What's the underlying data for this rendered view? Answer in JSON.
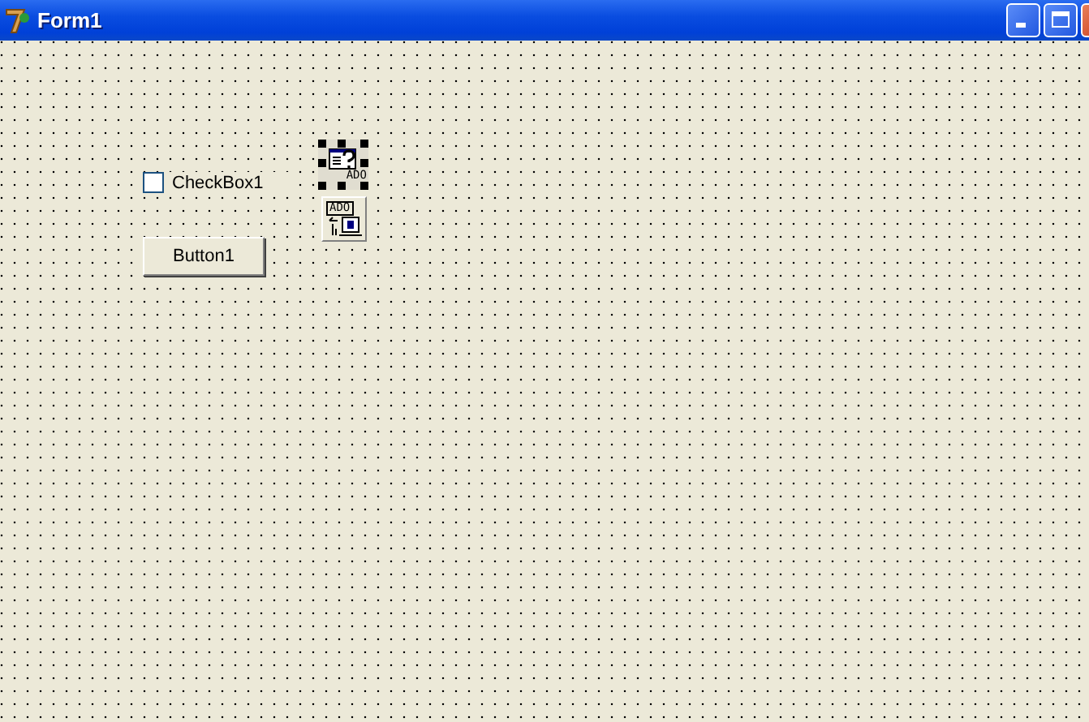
{
  "window": {
    "title": "Form1"
  },
  "form": {
    "checkbox": {
      "label": "CheckBox1",
      "checked": false
    },
    "button": {
      "label": "Button1"
    },
    "components": [
      {
        "label": "ADO",
        "kind": "query",
        "selected": true
      },
      {
        "label": "ADO",
        "kind": "connection",
        "selected": false
      }
    ]
  }
}
